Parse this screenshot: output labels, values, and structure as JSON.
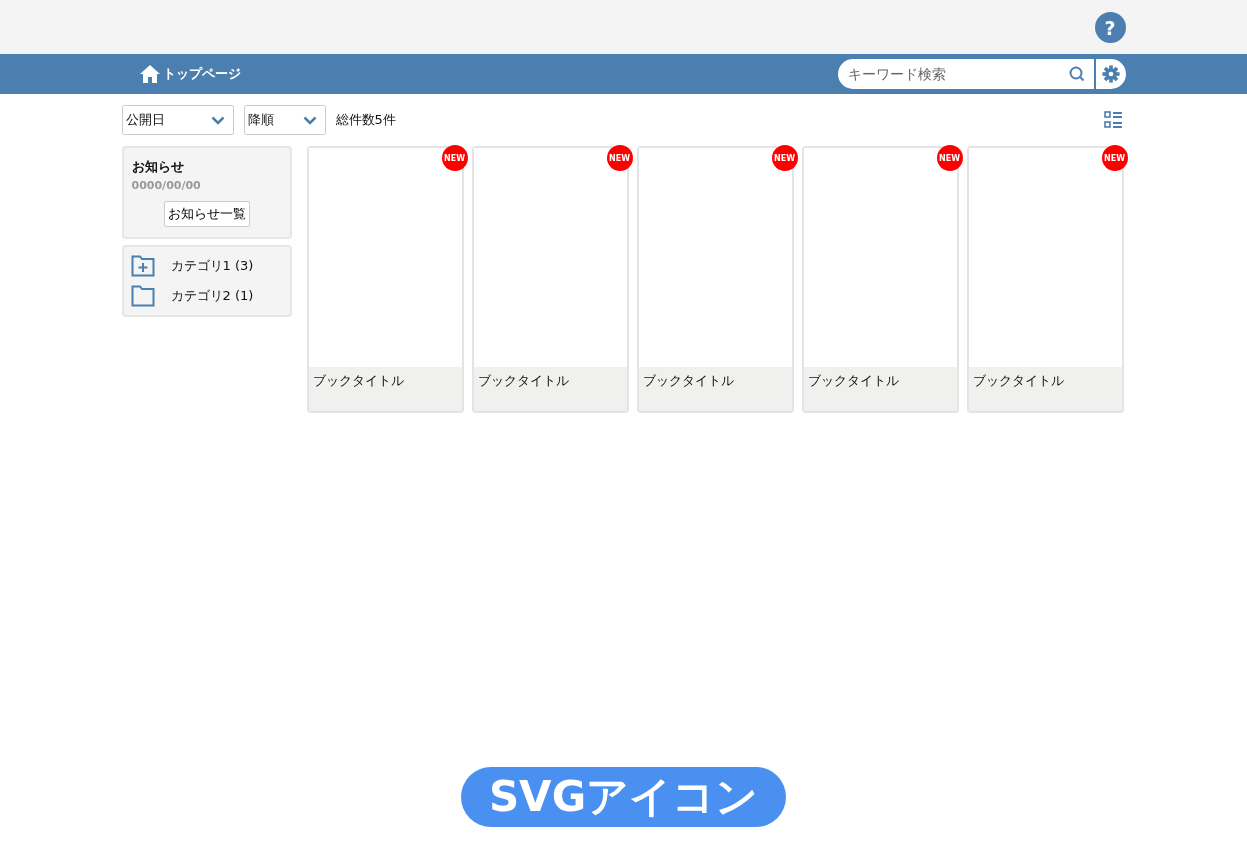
{
  "header": {
    "help_label": "?"
  },
  "nav": {
    "home_label": "トップページ",
    "search": {
      "placeholder": "キーワード検索"
    }
  },
  "toolbar": {
    "sort_field": "公開日",
    "sort_order": "降順",
    "total": "総件数5件"
  },
  "notice": {
    "title": "お知らせ",
    "date": "0000/00/00",
    "button": "お知らせ一覧"
  },
  "categories": [
    {
      "kind": "expandable",
      "label": "カテゴリ1 (3)"
    },
    {
      "kind": "folder",
      "label": "カテゴリ2 (1)"
    }
  ],
  "books": [
    {
      "title": "ブックタイトル",
      "new": true,
      "badge": "NEW"
    },
    {
      "title": "ブックタイトル",
      "new": true,
      "badge": "NEW"
    },
    {
      "title": "ブックタイトル",
      "new": true,
      "badge": "NEW"
    },
    {
      "title": "ブックタイトル",
      "new": true,
      "badge": "NEW"
    },
    {
      "title": "ブックタイトル",
      "new": true,
      "badge": "NEW"
    }
  ],
  "caption": "SVGアイコン"
}
